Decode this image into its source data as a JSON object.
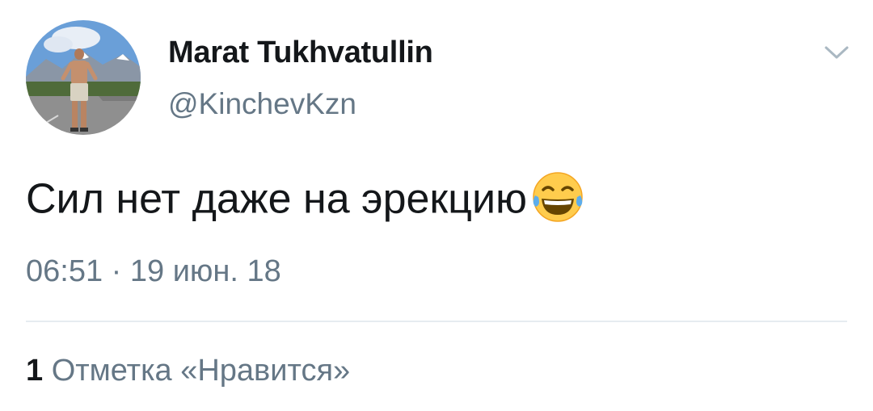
{
  "user": {
    "display_name": "Marat Tukhvatullin",
    "handle": "@KinchevKzn",
    "avatar_icon": "user-photo-avatar"
  },
  "tweet": {
    "text": "Сил нет даже на эрекцию",
    "emoji_icon": "face-with-tears-of-joy-emoji",
    "timestamp": "06:51 · 19 июн. 18"
  },
  "stats": {
    "likes_count": "1",
    "likes_label": "Отметка «Нравится»"
  },
  "menu": {
    "chevron_icon": "chevron-down-icon"
  },
  "colors": {
    "primary_text": "#14171a",
    "secondary_text": "#657786",
    "divider": "#e6ecf0",
    "background": "#ffffff"
  }
}
